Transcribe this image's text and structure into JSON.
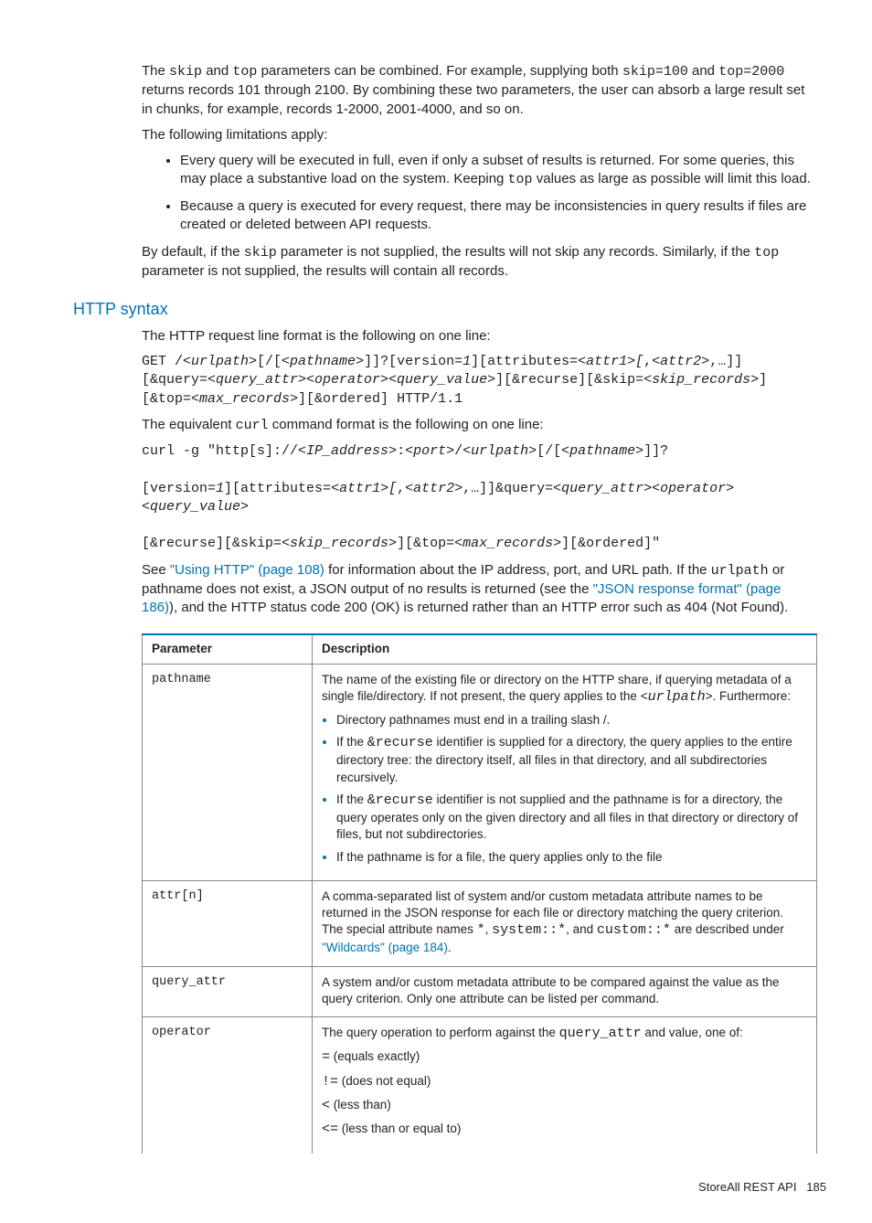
{
  "intro": {
    "p1_a": "The ",
    "p1_skip": "skip",
    "p1_b": " and ",
    "p1_top": "top",
    "p1_c": " parameters can be combined. For example, supplying both ",
    "p1_skip100": "skip=100",
    "p1_d": " and ",
    "p1_top2000": "top=2000",
    "p1_e": " returns records 101 through 2100. By combining these two parameters, the user can absorb a large result set in chunks, for example, records 1-2000, 2001-4000, and so on.",
    "p2": "The following limitations apply:",
    "b1_a": "Every query will be executed in full, even if only a subset of results is returned. For some queries, this may place a substantive load on the system. Keeping ",
    "b1_top": "top",
    "b1_b": " values as large as possible will limit this load.",
    "b2": "Because a query is executed for every request, there may be inconsistencies in query results if files are created or deleted between API requests.",
    "p3_a": "By default, if the ",
    "p3_skip": "skip",
    "p3_b": " parameter is not supplied, the results will not skip any records. Similarly, if the ",
    "p3_top": "top",
    "p3_c": " parameter is not supplied, the results will contain all records."
  },
  "http": {
    "heading": "HTTP syntax",
    "p1": "The HTTP request line format is the following on one line:",
    "p2_a": "The equivalent ",
    "p2_curl": "curl",
    "p2_b": " command format is the following on one line:",
    "p3_a": "See ",
    "p3_link1": "\"Using HTTP\" (page 108)",
    "p3_b": " for information about the IP address, port, and URL path. If the ",
    "p3_urlpath": "urlpath",
    "p3_c": " or pathname does not exist, a JSON output of no results is returned (see the ",
    "p3_link2": "\"JSON response format\" (page 186)",
    "p3_d": "), and the HTTP status code 200 (OK) is returned rather than an HTTP error such as 404 (Not Found)."
  },
  "table": {
    "h1": "Parameter",
    "h2": "Description",
    "r1": {
      "param": "pathname",
      "d1_a": "The name of the existing file or directory on the HTTP share, if querying metadata of a single file/directory. If not present, the query applies to the <",
      "d1_urlpath": "urlpath",
      "d1_b": ">. Furthermore:",
      "li1": "Directory pathnames must end in a trailing slash /.",
      "li2_a": "If the ",
      "li2_recurse": "&recurse",
      "li2_b": " identifier is supplied for a directory, the query applies to the entire directory tree: the directory itself, all files in that directory, and all subdirectories recursively.",
      "li3_a": "If the ",
      "li3_recurse": "&recurse",
      "li3_b": " identifier is not supplied and the pathname is for a directory, the query operates only on the given directory and all files in that directory or directory of files, but not subdirectories.",
      "li4": "If the pathname is for a file, the query applies only to the file"
    },
    "r2": {
      "param": "attr[n]",
      "d_a": "A comma-separated list of system and/or custom metadata attribute names to be returned in the JSON response for each file or directory matching the query criterion. The special attribute names ",
      "d_star": "*",
      "d_b": ", ",
      "d_sys": "system::*",
      "d_c": ", and ",
      "d_cust": "custom::*",
      "d_d": " are described under ",
      "d_link": "\"Wildcards\" (page 184)",
      "d_e": "."
    },
    "r3": {
      "param": "query_attr",
      "d": "A system and/or custom metadata attribute to be compared against the value as the query criterion. Only one attribute can be listed per command."
    },
    "r4": {
      "param": "operator",
      "d_a": "The query operation to perform against the ",
      "d_qa": "query_attr",
      "d_b": " and value, one of:",
      "op1_s": "=",
      "op1_t": " (equals exactly)",
      "op2_s": "!=",
      "op2_t": " (does not equal)",
      "op3_s": "<",
      "op3_t": " (less than)",
      "op4_s": "<=",
      "op4_t": " (less than or equal to)"
    }
  },
  "footer": {
    "label": "StoreAll REST API",
    "page": "185"
  }
}
